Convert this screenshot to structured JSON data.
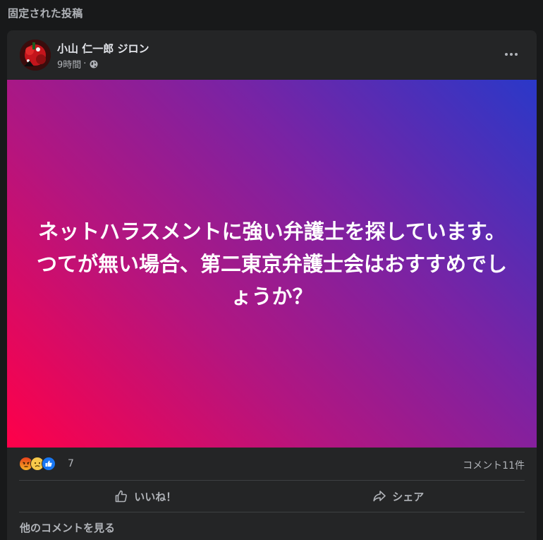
{
  "section": {
    "title": "固定された投稿"
  },
  "post": {
    "author": "小山 仁一郎 ジロン",
    "time": "9時間",
    "separator": "·",
    "audience_icon": "globe-icon",
    "more_icon": "more-horizontal-icon",
    "banner_text": "ネットハラスメントに強い弁護士を探しています。\nつてが無い場合、第二東京弁護士会はおすすめでしょうか？",
    "banner_colors": [
      "#ff0049",
      "#b4157f",
      "#7a23a4",
      "#2a38c8"
    ]
  },
  "reactions": {
    "icons": [
      "angry-reaction-icon",
      "sad-reaction-icon",
      "like-reaction-icon"
    ],
    "count": "7",
    "comments": "コメント11件"
  },
  "actions": {
    "like_label": "いいね！",
    "like_icon": "thumbs-up-icon",
    "share_label": "シェア",
    "share_icon": "share-arrow-icon"
  },
  "comments": {
    "more_label": "他のコメントを見る"
  }
}
